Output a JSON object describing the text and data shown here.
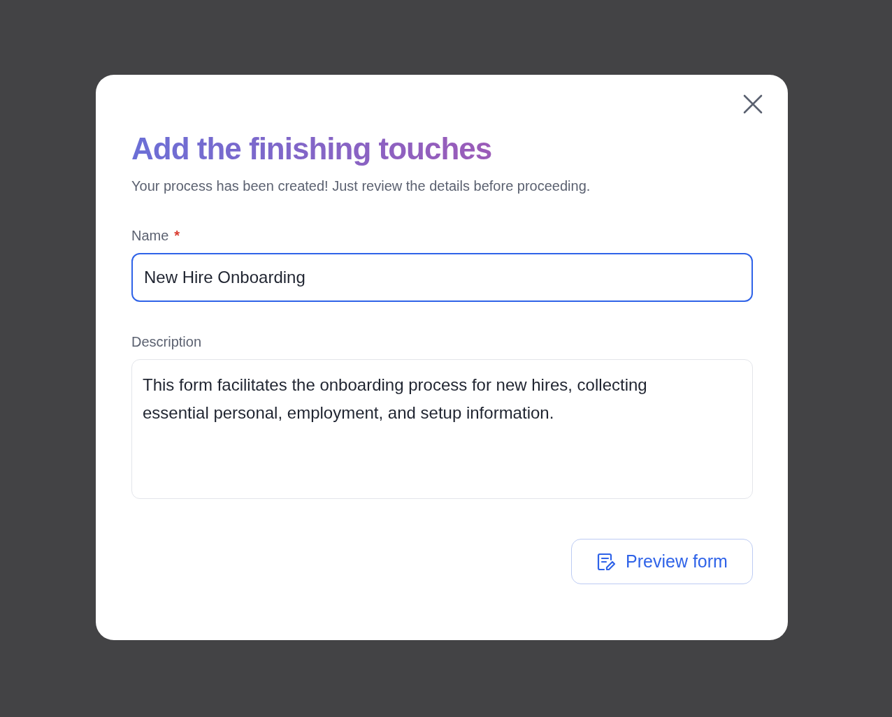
{
  "dialog": {
    "title": "Add the finishing touches",
    "subtitle": "Your process has been created! Just review the details before proceeding.",
    "fields": [
      {
        "kind": "input",
        "label": "Name",
        "required_mark": "*",
        "value": "New Hire Onboarding",
        "focused": true
      },
      {
        "kind": "textarea",
        "label": "Description",
        "value": "This form facilitates the onboarding process for new hires, collecting essential personal, employment, and setup information.",
        "focused": false
      }
    ],
    "button": {
      "label": "Preview form"
    }
  }
}
